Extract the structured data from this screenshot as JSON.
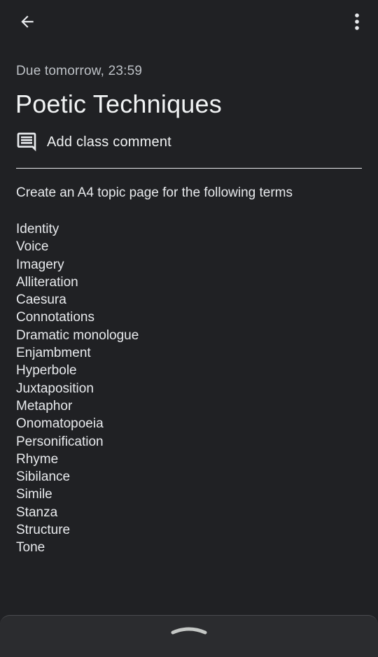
{
  "topbar": {
    "back_icon": "arrow-back-icon",
    "more_icon": "more-vert-icon"
  },
  "assignment": {
    "due": "Due tomorrow, 23:59",
    "title": "Poetic Techniques",
    "comment_label": "Add class comment",
    "comment_icon": "comment-icon",
    "instructions": "Create an A4 topic page for the following terms",
    "terms": [
      "Identity",
      "Voice",
      "Imagery",
      "Alliteration",
      "Caesura",
      "Connotations",
      "Dramatic monologue",
      "Enjambment",
      "Hyperbole",
      "Juxtaposition",
      "Metaphor",
      "Onomatopoeia",
      "Personification",
      "Rhyme",
      "Sibilance",
      "Simile",
      "Stanza",
      "Structure",
      "Tone"
    ]
  },
  "bottom_sheet": {
    "handle_icon": "chevron-up-icon"
  },
  "colors": {
    "background": "#202124",
    "text": "#e8eaed",
    "muted": "#bdc1c6"
  }
}
